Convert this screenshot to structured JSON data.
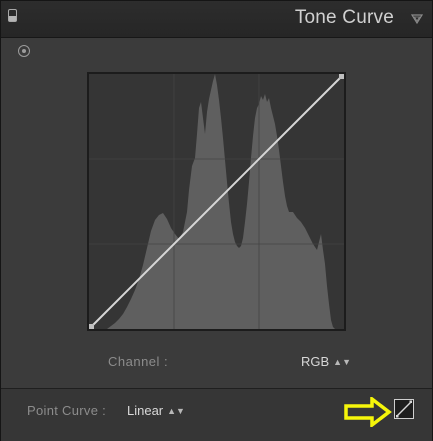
{
  "panel": {
    "title": "Tone Curve",
    "icons": {
      "solo": "panel-switch-icon",
      "collapse": "triangle-down-icon",
      "target": "targeted-adjustment-icon"
    }
  },
  "channel": {
    "label": "Channel :",
    "value": "RGB"
  },
  "point_curve": {
    "label": "Point Curve :",
    "value": "Linear"
  },
  "edit_point_curve": {
    "icon": "curve-edit-icon"
  },
  "annotation": {
    "color": "#f5f50a",
    "icon": "arrow-right-icon"
  },
  "colors": {
    "panel_bg": "#3b3b3b",
    "header_bg": "#2a2a2a",
    "histogram": "#5e5e5e",
    "curve_line": "#d6d6d6"
  },
  "curve": {
    "points": [
      [
        0,
        0
      ],
      [
        255,
        255
      ]
    ],
    "type": "linear"
  }
}
